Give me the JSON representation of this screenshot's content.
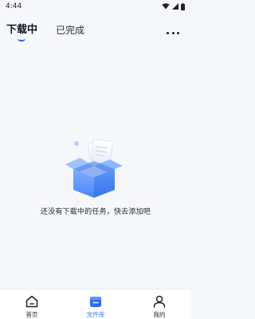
{
  "status_bar": {
    "time": "4:44"
  },
  "header": {
    "tabs": [
      {
        "label": "下载中",
        "active": true
      },
      {
        "label": "已完成",
        "active": false
      }
    ]
  },
  "empty_state": {
    "message": "还没有下载中的任务，快去添加吧"
  },
  "bottom_nav": {
    "items": [
      {
        "label": "首页",
        "icon": "home-icon",
        "active": false
      },
      {
        "label": "文件库",
        "icon": "file-library-icon",
        "active": true
      },
      {
        "label": "我的",
        "icon": "profile-icon",
        "active": false
      }
    ]
  },
  "colors": {
    "accent": "#2f6bff",
    "background": "#f6f7fb"
  }
}
